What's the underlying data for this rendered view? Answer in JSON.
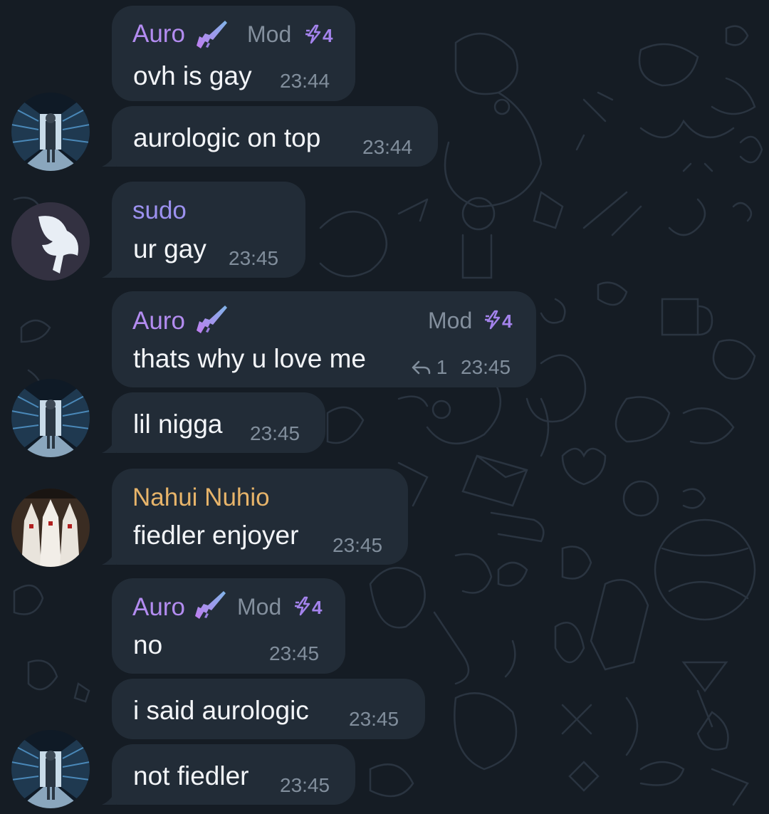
{
  "colors": {
    "background": "#151c24",
    "bubble": "#222c37",
    "auro_name": "#b38cf0",
    "sudo_name": "#9c91ef",
    "nahui_name": "#e7b46a",
    "timestamp": "#818e9c"
  },
  "badges": {
    "mod": "Mod",
    "boost_count": "4",
    "gun_icon": "rifle-emoji-icon",
    "bolt_icon": "boost-bolt-icon"
  },
  "messages": [
    {
      "sender": "Auro",
      "text": "ovh is gay",
      "time": "23:44"
    },
    {
      "text": "aurologic on top",
      "time": "23:44"
    },
    {
      "sender": "sudo",
      "text": "ur gay",
      "time": "23:45"
    },
    {
      "sender": "Auro",
      "text": "thats why u love me",
      "time": "23:45",
      "replies": "1"
    },
    {
      "text": "lil nigga",
      "time": "23:45"
    },
    {
      "sender": "Nahui Nuhio",
      "text": "fiedler enjoyer",
      "time": "23:45"
    },
    {
      "sender": "Auro",
      "text": "no",
      "time": "23:45"
    },
    {
      "text": "i said aurologic",
      "time": "23:45"
    },
    {
      "text": "not fiedler",
      "time": "23:45"
    }
  ]
}
